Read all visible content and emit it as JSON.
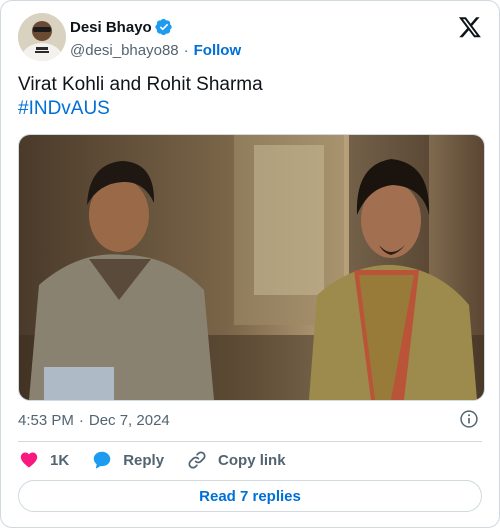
{
  "author": {
    "display_name": "Desi Bhayo",
    "handle": "@desi_bhayo88",
    "separator": "·",
    "follow_label": "Follow",
    "verified": true
  },
  "tweet": {
    "text_line1": "Virat Kohli and Rohit Sharma",
    "hashtag": "#INDvAUS",
    "time": "4:53 PM",
    "meta_separator": "·",
    "date": "Dec 7, 2024"
  },
  "actions": {
    "like_count": "1K",
    "reply_label": "Reply",
    "copy_link_label": "Copy link"
  },
  "read_replies_label": "Read 7 replies",
  "colors": {
    "accent": "#006fd6",
    "verified": "#1d9bf0",
    "like": "#f91880",
    "text": "#0f1419",
    "secondary": "#536471",
    "border": "#cfd9de"
  },
  "icons": {
    "platform": "x-logo-icon",
    "verified": "verified-badge-icon",
    "info": "info-icon",
    "like": "heart-icon",
    "reply": "speech-bubble-icon",
    "copy_link": "link-icon"
  }
}
